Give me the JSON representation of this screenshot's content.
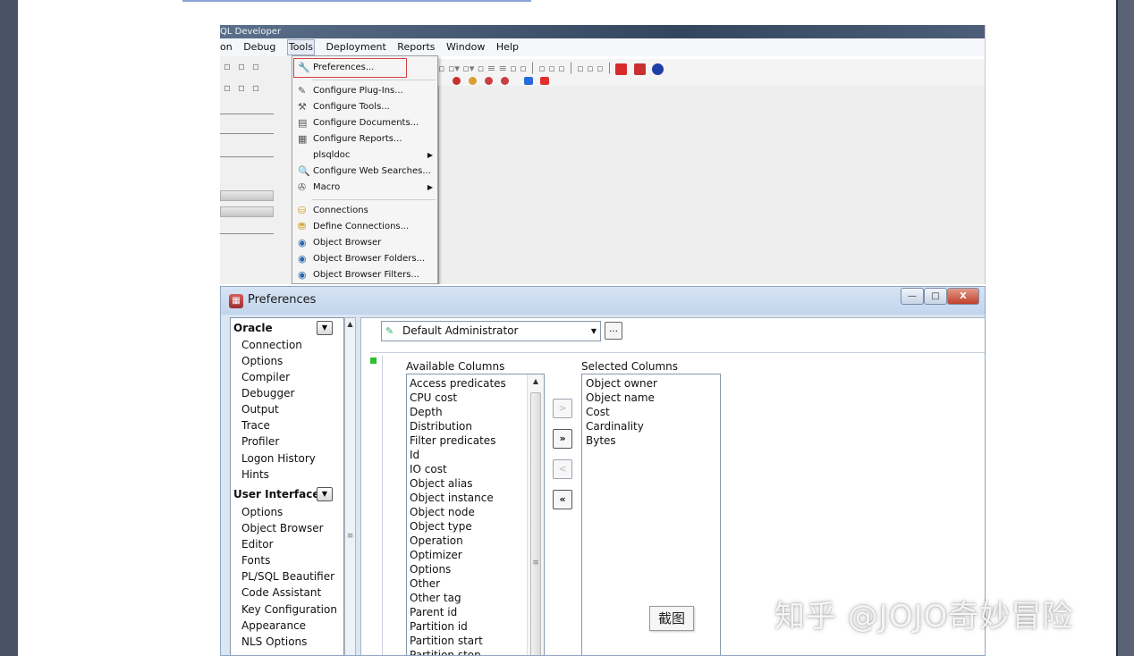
{
  "screenshot_top": {
    "window_title": "QL Developer",
    "menubar": [
      "on",
      "Debug",
      "Tools",
      "Deployment",
      "Reports",
      "Window",
      "Help"
    ],
    "tools_menu": {
      "items": [
        {
          "label": "Preferences...",
          "icon": "wrench-icon"
        },
        {
          "label": "Configure Plug-Ins...",
          "icon": "plug-icon"
        },
        {
          "label": "Configure Tools...",
          "icon": "tools-icon"
        },
        {
          "label": "Configure Documents...",
          "icon": "documents-icon"
        },
        {
          "label": "Configure Reports...",
          "icon": "reports-icon"
        },
        {
          "label": "plsqldoc",
          "icon": "",
          "submenu": true
        },
        {
          "label": "Configure Web Searches...",
          "icon": "web-search-icon"
        },
        {
          "label": "Macro",
          "icon": "macro-icon",
          "submenu": true
        },
        {
          "label": "Connections",
          "icon": "connections-icon"
        },
        {
          "label": "Define Connections...",
          "icon": "define-connections-icon"
        },
        {
          "label": "Object Browser",
          "icon": "object-browser-icon"
        },
        {
          "label": "Object Browser Folders...",
          "icon": "browser-folders-icon"
        },
        {
          "label": "Object Browser Filters...",
          "icon": "browser-filters-icon"
        }
      ]
    }
  },
  "dialog": {
    "title": "Preferences",
    "window_buttons": {
      "minimize": "—",
      "maximize": "□",
      "close": "X"
    },
    "nav": {
      "groups": [
        {
          "label": "Oracle",
          "items": [
            "Connection",
            "Options",
            "Compiler",
            "Debugger",
            "Output",
            "Trace",
            "Profiler",
            "Logon History",
            "Hints"
          ]
        },
        {
          "label": "User Interface",
          "items": [
            "Options",
            "Object Browser",
            "Editor",
            "Fonts",
            "PL/SQL Beautifier",
            "Code Assistant",
            "Key Configuration",
            "Appearance",
            "NLS Options"
          ]
        }
      ]
    },
    "profile_select": {
      "value": "Default Administrator",
      "more_button": "…"
    },
    "available_columns": {
      "label": "Available Columns",
      "items": [
        "Access predicates",
        "CPU cost",
        "Depth",
        "Distribution",
        "Filter predicates",
        "Id",
        "IO cost",
        "Object alias",
        "Object instance",
        "Object node",
        "Object type",
        "Operation",
        "Optimizer",
        "Options",
        "Other",
        "Other tag",
        "Parent id",
        "Partition id",
        "Partition start",
        "Partition stop"
      ]
    },
    "selected_columns": {
      "label": "Selected Columns",
      "items": [
        "Object owner",
        "Object name",
        "Cost",
        "Cardinality",
        "Bytes"
      ]
    },
    "move_buttons": {
      "add": ">",
      "add_all": "»",
      "remove": "<",
      "remove_all": "«"
    }
  },
  "caption": "截图",
  "watermark": "知乎 @JOJO奇妙冒险"
}
